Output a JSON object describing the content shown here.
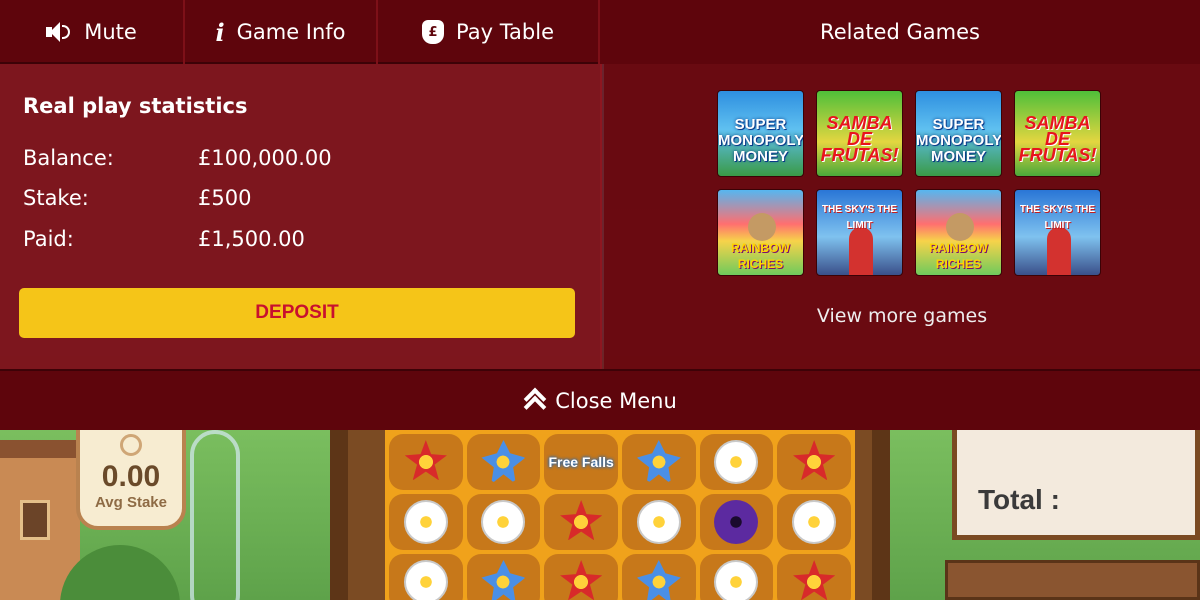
{
  "tabs": {
    "mute_label": "Mute",
    "game_info_label": "Game Info",
    "pay_table_label": "Pay Table",
    "related_games_label": "Related Games"
  },
  "stats": {
    "title": "Real play statistics",
    "balance_label": "Balance:",
    "balance_value": "£100,000.00",
    "stake_label": "Stake:",
    "stake_value": "£500",
    "paid_label": "Paid:",
    "paid_value": "£1,500.00",
    "deposit_label": "DEPOSIT"
  },
  "related_games": {
    "items": [
      {
        "title": "SUPER MONOPOLY MONEY",
        "style": "monopoly"
      },
      {
        "title": "SAMBA DE FRUTAS!",
        "style": "samba"
      },
      {
        "title": "SUPER MONOPOLY MONEY",
        "style": "monopoly"
      },
      {
        "title": "SAMBA DE FRUTAS!",
        "style": "samba"
      },
      {
        "title": "RAINBOW RICHES",
        "style": "rainbow"
      },
      {
        "title": "THE SKY'S THE LIMIT",
        "style": "sky"
      },
      {
        "title": "RAINBOW RICHES",
        "style": "rainbow"
      },
      {
        "title": "THE SKY'S THE LIMIT",
        "style": "sky"
      }
    ],
    "view_more_label": "View more games"
  },
  "close_menu_label": "Close Menu",
  "game": {
    "avg_stake_value": "0.00",
    "avg_stake_label": "Avg Stake",
    "free_falls_label": "Free Falls",
    "total_label": "Total :"
  },
  "colors": {
    "menu_bg": "#5e050c",
    "panel_bg": "#80141c",
    "deposit_bg": "#f5c518",
    "deposit_text": "#c8102e"
  }
}
